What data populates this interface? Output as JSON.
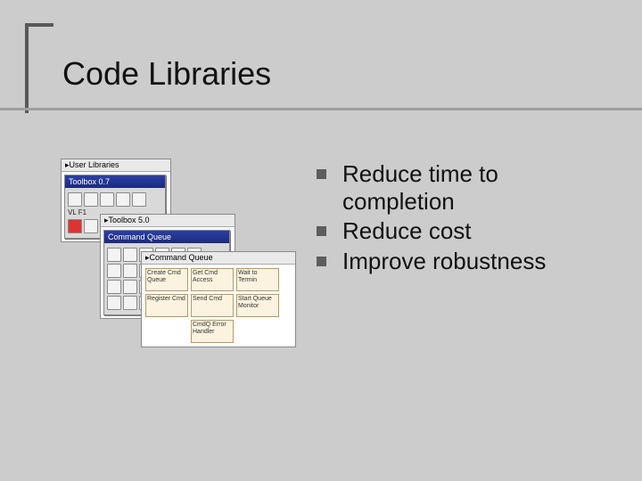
{
  "title": "Code Libraries",
  "bullets": [
    "Reduce time to completion",
    "Reduce cost",
    "Improve robustness"
  ],
  "windows": {
    "w1": {
      "title_prefix": "User Libraries",
      "titlebar": "Toolbox 0.7"
    },
    "w2": {
      "title_prefix": "Toolbox 5.0",
      "titlebar": "Command Queue"
    },
    "w3": {
      "title_prefix": "Command Queue"
    }
  },
  "palette": {
    "cells": [
      "Create Cmd Queue",
      "Get Cmd Access",
      "Wait to Termin",
      "Register Cmd",
      "Send Cmd",
      "Start Queue Monitor",
      "",
      "CmdQ Error Handler",
      ""
    ]
  }
}
